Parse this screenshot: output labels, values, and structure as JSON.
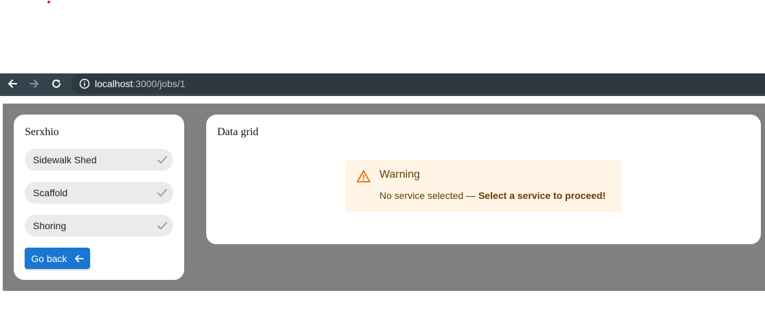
{
  "browser": {
    "url_host": "localhost",
    "url_rest": ":3000/jobs/1",
    "icons": [
      "back-arrow-icon",
      "forward-arrow-icon",
      "reload-icon",
      "info-icon"
    ]
  },
  "sidebar": {
    "title": "Serxhio",
    "services": [
      {
        "label": "Sidewalk Shed",
        "icon": "check-icon"
      },
      {
        "label": "Scaffold",
        "icon": "check-icon"
      },
      {
        "label": "Shoring",
        "icon": "check-icon"
      }
    ],
    "back_button": {
      "label": "Go back",
      "icon": "arrow-left-icon"
    }
  },
  "main": {
    "title": "Data grid",
    "alert": {
      "title": "Warning",
      "message": "No service selected — ",
      "emphasis": "Select a service to proceed!",
      "icon": "warning-icon",
      "accent_color": "#ed6c02"
    }
  },
  "colors": {
    "primary": "#1976d2",
    "background": "#808080",
    "toolbar": "#35434c"
  }
}
